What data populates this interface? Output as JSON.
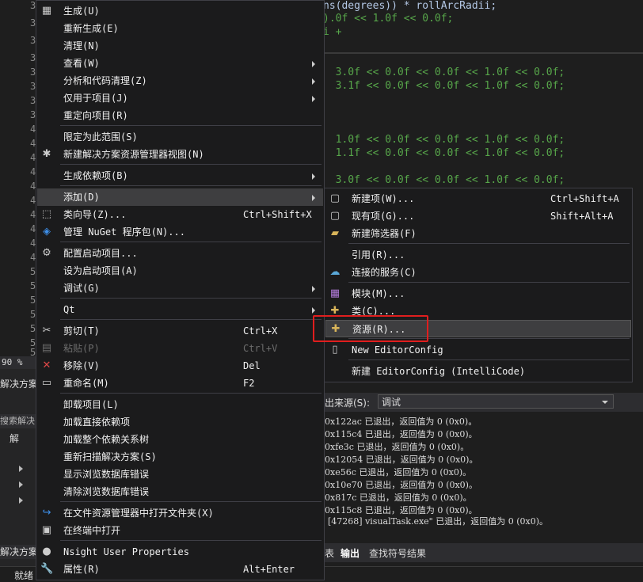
{
  "editor": {
    "line_numbers": [
      "3",
      "3",
      "3",
      "3",
      "3",
      "3",
      "3",
      "3",
      "4",
      "4",
      "4",
      "4",
      "4",
      "4",
      "4",
      "4",
      "4",
      "4",
      "5",
      "5",
      "5",
      "5",
      "5",
      "5",
      "5"
    ],
    "code_lines": [
      {
        "text": "ns(degrees)) * rollArcRadii;",
        "green": false
      },
      {
        "text": ").0f << 1.0f << 0.0f;",
        "green": true
      },
      {
        "text": "i +",
        "green": true
      },
      {
        "text": "  3.0f << 0.0f << 0.0f << 1.0f << 0.0f;",
        "green": true
      },
      {
        "text": "  3.1f << 0.0f << 0.0f << 1.0f << 0.0f;",
        "green": true
      },
      {
        "text": "  1.0f << 0.0f << 0.0f << 1.0f << 0.0f;",
        "green": true
      },
      {
        "text": "  1.1f << 0.0f << 0.0f << 1.0f << 0.0f;",
        "green": true
      },
      {
        "text": "  3.0f << 0.0f << 0.0f << 1.0f << 0.0f;",
        "green": true
      }
    ],
    "zoom": "90 %"
  },
  "solution_explorer": {
    "title": "解决方案",
    "search": "搜索解决",
    "root": "解",
    "bottom_tab": "解决方案"
  },
  "output": {
    "source_label": "出来源(S):",
    "source_value": "调试",
    "lines": [
      "0x122ac 已退出，返回值为 0 (0x0)。",
      "0x115c4 已退出，返回值为 0 (0x0)。",
      "0xfe3c 已退出，返回值为 0 (0x0)。",
      "0x12054 已退出，返回值为 0 (0x0)。",
      "0xe56c 已退出，返回值为 0 (0x0)。",
      "0x10e70 已退出，返回值为 0 (0x0)。",
      "0x817c 已退出，返回值为 0 (0x0)。",
      "0x115c8 已退出，返回值为 0 (0x0)。",
      "[47268] visualTask.exe\" 已退出，返回值为 0 (0x0)。"
    ],
    "tabs": [
      "表",
      "输出",
      "查找符号结果"
    ]
  },
  "status": {
    "text": "就绪"
  },
  "main_menu": {
    "items": [
      {
        "label": "生成(U)",
        "icon": "▦",
        "shortcut": "",
        "sub": false
      },
      {
        "label": "重新生成(E)",
        "icon": "",
        "shortcut": "",
        "sub": false
      },
      {
        "label": "清理(N)",
        "icon": "",
        "shortcut": "",
        "sub": false
      },
      {
        "label": "查看(W)",
        "icon": "",
        "shortcut": "",
        "sub": true
      },
      {
        "label": "分析和代码清理(Z)",
        "icon": "",
        "shortcut": "",
        "sub": true
      },
      {
        "label": "仅用于项目(J)",
        "icon": "",
        "shortcut": "",
        "sub": true
      },
      {
        "label": "重定向项目(R)",
        "icon": "",
        "shortcut": "",
        "sub": false
      },
      {
        "label": "限定为此范围(S)",
        "icon": "",
        "shortcut": "",
        "sub": false
      },
      {
        "label": "新建解决方案资源管理器视图(N)",
        "icon": "✱",
        "shortcut": "",
        "sub": false
      },
      {
        "label": "生成依赖项(B)",
        "icon": "",
        "shortcut": "",
        "sub": true
      },
      {
        "label": "添加(D)",
        "icon": "",
        "shortcut": "",
        "sub": true
      },
      {
        "label": "类向导(Z)...",
        "icon": "⬚",
        "shortcut": "Ctrl+Shift+X",
        "sub": false
      },
      {
        "label": "管理 NuGet 程序包(N)...",
        "icon": "◈",
        "shortcut": "",
        "sub": false
      },
      {
        "label": "配置启动项目...",
        "icon": "⚙",
        "shortcut": "",
        "sub": false
      },
      {
        "label": "设为启动项目(A)",
        "icon": "",
        "shortcut": "",
        "sub": false
      },
      {
        "label": "调试(G)",
        "icon": "",
        "shortcut": "",
        "sub": true
      },
      {
        "label": "Qt",
        "icon": "",
        "shortcut": "",
        "sub": true
      },
      {
        "label": "剪切(T)",
        "icon": "✂",
        "shortcut": "Ctrl+X",
        "sub": false
      },
      {
        "label": "粘贴(P)",
        "icon": "▤",
        "shortcut": "Ctrl+V",
        "sub": false
      },
      {
        "label": "移除(V)",
        "icon": "✕",
        "shortcut": "Del",
        "sub": false
      },
      {
        "label": "重命名(M)",
        "icon": "▭",
        "shortcut": "F2",
        "sub": false
      },
      {
        "label": "卸载项目(L)",
        "icon": "",
        "shortcut": "",
        "sub": false
      },
      {
        "label": "加载直接依赖项",
        "icon": "",
        "shortcut": "",
        "sub": false
      },
      {
        "label": "加载整个依赖关系树",
        "icon": "",
        "shortcut": "",
        "sub": false
      },
      {
        "label": "重新扫描解决方案(S)",
        "icon": "",
        "shortcut": "",
        "sub": false
      },
      {
        "label": "显示浏览数据库错误",
        "icon": "",
        "shortcut": "",
        "sub": false
      },
      {
        "label": "清除浏览数据库错误",
        "icon": "",
        "shortcut": "",
        "sub": false
      },
      {
        "label": "在文件资源管理器中打开文件夹(X)",
        "icon": "↪",
        "shortcut": "",
        "sub": false
      },
      {
        "label": "在终端中打开",
        "icon": "▣",
        "shortcut": "",
        "sub": false
      },
      {
        "label": "Nsight User Properties",
        "icon": "●",
        "shortcut": "",
        "sub": false
      },
      {
        "label": "属性(R)",
        "icon": "🔧",
        "shortcut": "Alt+Enter",
        "sub": false
      }
    ]
  },
  "sub_menu": {
    "items": [
      {
        "label": "新建项(W)...",
        "icon": "▢",
        "shortcut": "Ctrl+Shift+A"
      },
      {
        "label": "现有项(G)...",
        "icon": "▢",
        "shortcut": "Shift+Alt+A"
      },
      {
        "label": "新建筛选器(F)",
        "icon": "▰",
        "shortcut": ""
      },
      {
        "label": "引用(R)...",
        "icon": "",
        "shortcut": ""
      },
      {
        "label": "连接的服务(C)",
        "icon": "☁",
        "shortcut": ""
      },
      {
        "label": "模块(M)...",
        "icon": "▦",
        "shortcut": ""
      },
      {
        "label": "类(C)...",
        "icon": "✚",
        "shortcut": ""
      },
      {
        "label": "资源(R)...",
        "icon": "✚",
        "shortcut": ""
      },
      {
        "label": "New EditorConfig",
        "icon": "▯",
        "shortcut": ""
      },
      {
        "label": "新建 EditorConfig (IntelliCode)",
        "icon": "",
        "shortcut": ""
      }
    ]
  }
}
